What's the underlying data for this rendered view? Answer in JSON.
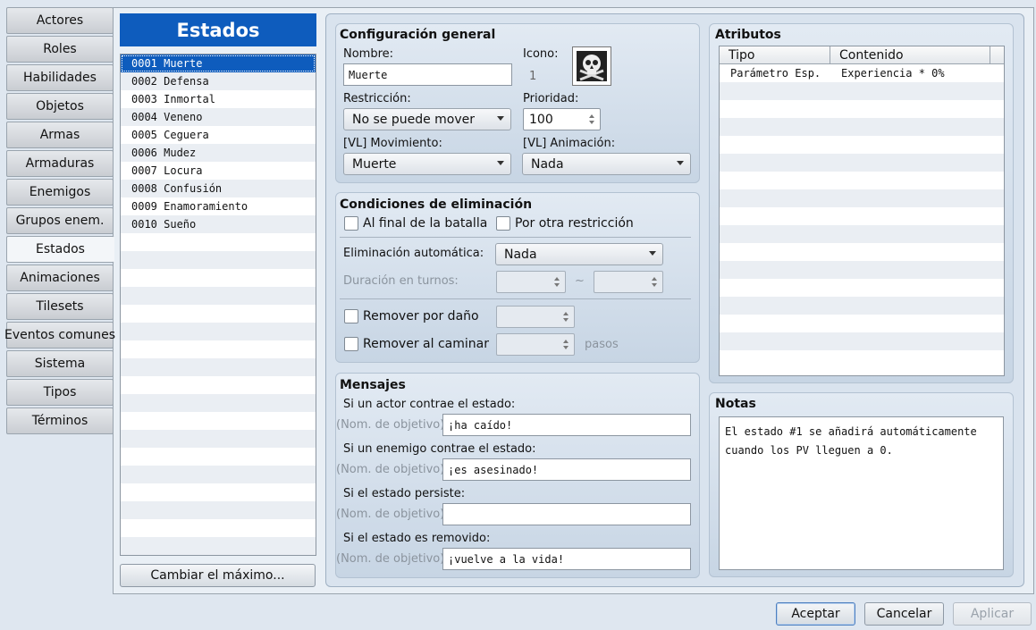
{
  "tabs": [
    "Actores",
    "Roles",
    "Habilidades",
    "Objetos",
    "Armas",
    "Armaduras",
    "Enemigos",
    "Grupos enem.",
    "Estados",
    "Animaciones",
    "Tilesets",
    "Eventos comunes",
    "Sistema",
    "Tipos",
    "Términos"
  ],
  "active_tab": "Estados",
  "list": {
    "title": "Estados",
    "items": [
      "0001 Muerte",
      "0002 Defensa",
      "0003 Inmortal",
      "0004 Veneno",
      "0005 Ceguera",
      "0006 Mudez",
      "0007 Locura",
      "0008 Confusión",
      "0009 Enamoramiento",
      "0010 Sueño"
    ],
    "selected_index": 0,
    "max_button": "Cambiar el máximo..."
  },
  "general": {
    "title": "Configuración general",
    "name_label": "Nombre:",
    "name_value": "Muerte",
    "icon_label": "Icono:",
    "icon_index": "1",
    "icon_name": "skull-crossbones-icon",
    "restriction_label": "Restricción:",
    "restriction_value": "No se puede mover",
    "priority_label": "Prioridad:",
    "priority_value": "100",
    "motion_label": "[VL] Movimiento:",
    "motion_value": "Muerte",
    "overlay_label": "[VL] Animación:",
    "overlay_value": "Nada"
  },
  "removal": {
    "title": "Condiciones de eliminación",
    "end_battle": "Al final de la batalla",
    "by_restriction": "Por otra restricción",
    "auto_label": "Eliminación automática:",
    "auto_value": "Nada",
    "duration_label": "Duración en turnos:",
    "tilde": "~",
    "by_damage": "Remover por daño",
    "by_walking": "Remover al caminar",
    "steps": "pasos"
  },
  "messages": {
    "title": "Mensajes",
    "prefix": "(Nom. de objetivo)",
    "actor_label": "Si un actor contrae el estado:",
    "actor_value": "¡ha caído!",
    "enemy_label": "Si un enemigo contrae el estado:",
    "enemy_value": "¡es asesinado!",
    "persist_label": "Si el estado persiste:",
    "persist_value": "",
    "removed_label": "Si el estado es removido:",
    "removed_value": "¡vuelve a la vida!"
  },
  "traits": {
    "title": "Atributos",
    "col_type": "Tipo",
    "col_content": "Contenido",
    "rows": [
      {
        "type": "Parámetro Esp.",
        "content": "Experiencia * 0%"
      }
    ]
  },
  "notes": {
    "title": "Notas",
    "text": "El estado #1 se añadirá automáticamente\ncuando los PV lleguen a 0."
  },
  "footer": {
    "ok": "Aceptar",
    "cancel": "Cancelar",
    "apply": "Aplicar"
  },
  "colors": {
    "selection": "#0e5cbd",
    "accent_border": "#4d7fbf"
  }
}
